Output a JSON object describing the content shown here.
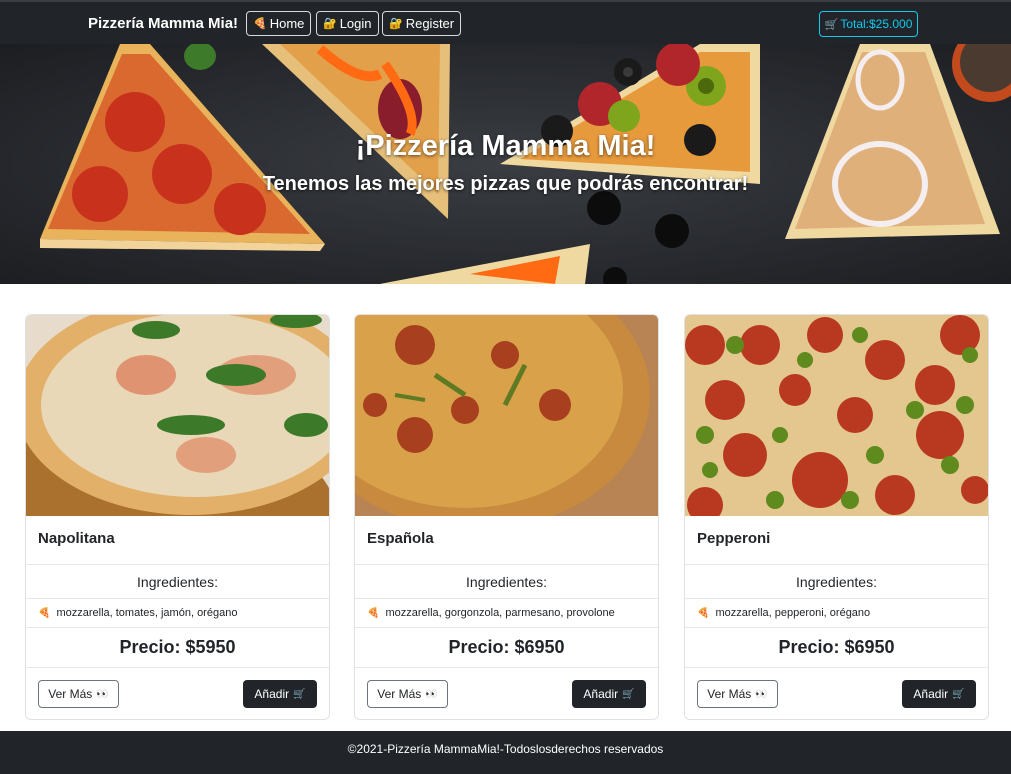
{
  "navbar": {
    "brand": "Pizzería Mamma Mia!",
    "home_label": "Home",
    "login_label": "Login",
    "register_label": "Register",
    "total_label": "Total:$25.000",
    "icons": {
      "home": "pizza-slice-icon",
      "login": "lock-icon",
      "register": "lock-icon",
      "total": "cart-icon"
    }
  },
  "hero": {
    "title": "¡Pizzería Mamma Mia!",
    "subtitle": "Tenemos las mejores pizzas que podrás encontrar!"
  },
  "cards": [
    {
      "name": "Napolitana",
      "ingredients_heading": "Ingredientes:",
      "ingredients": "mozzarella, tomates, jamón, orégano",
      "price": "Precio: $5950",
      "more_label": "Ver Más",
      "add_label": "Añadir"
    },
    {
      "name": "Española",
      "ingredients_heading": "Ingredientes:",
      "ingredients": "mozzarella, gorgonzola, parmesano, provolone",
      "price": "Precio: $6950",
      "more_label": "Ver Más",
      "add_label": "Añadir"
    },
    {
      "name": "Pepperoni",
      "ingredients_heading": "Ingredientes:",
      "ingredients": "mozzarella, pepperoni, orégano",
      "price": "Precio: $6950",
      "more_label": "Ver Más",
      "add_label": "Añadir"
    }
  ],
  "footer": {
    "text": "©2021-Pizzería MammaMia!-Todoslosderechos reservados"
  },
  "colors": {
    "navbar_bg": "#212529",
    "total_accent": "#0dcaf0",
    "button_dark": "#212529"
  }
}
